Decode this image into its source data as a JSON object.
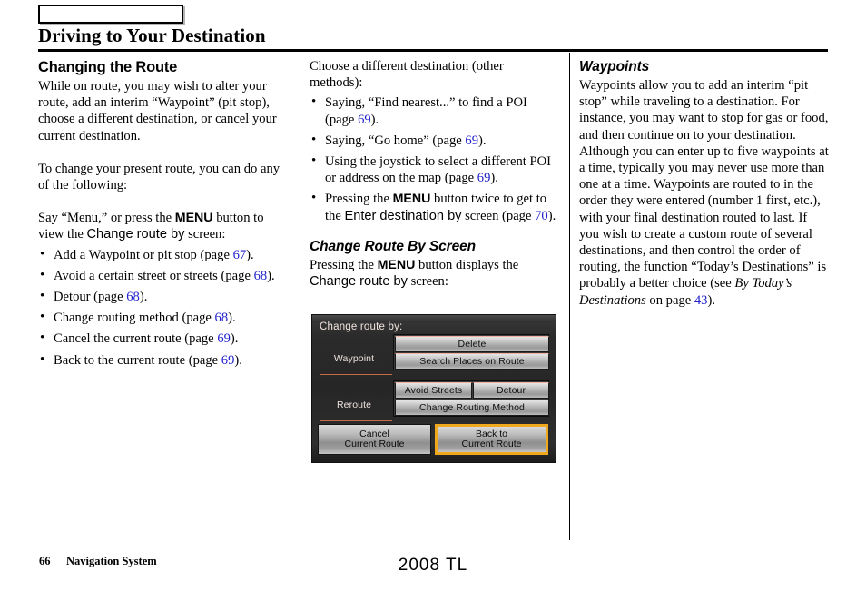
{
  "header": {
    "box_label": "",
    "title": "Driving to Your Destination"
  },
  "left_column": {
    "heading": "Changing the Route",
    "para1": "While on route, you may wish to alter your route, add an interim “Waypoint” (pit stop), choose a different destination, or cancel your current destination.",
    "para2": "To change your present route, you can do any of the following:",
    "para3_a": "Say “Menu,” or press the ",
    "para3_menu": "MENU",
    "para3_b": " button to view the ",
    "para3_screen": "Change route by",
    "para3_c": " screen:",
    "bullets": [
      {
        "text_a": "Add a Waypoint or pit stop (page ",
        "page": "67",
        "text_b": ")."
      },
      {
        "text_a": "Avoid a certain street or streets (page ",
        "page": "68",
        "text_b": ")."
      },
      {
        "text_a": "Detour (page ",
        "page": "68",
        "text_b": ")."
      },
      {
        "text_a": "Change routing method (page ",
        "page": "68",
        "text_b": ")."
      },
      {
        "text_a": "Cancel the current route (page ",
        "page": "69",
        "text_b": ")."
      },
      {
        "text_a": "Back to the current route (page ",
        "page": "69",
        "text_b": ")."
      }
    ]
  },
  "mid_column": {
    "intro": "Choose a different destination (other methods):",
    "bullets": [
      {
        "text_a": "Saying, “Find nearest...” to find a POI (page ",
        "page": "69",
        "text_b": ")."
      },
      {
        "text_a": "Saying, “Go home” (page ",
        "page": "69",
        "text_b": ")."
      },
      {
        "text_a": "Using the joystick to select a different POI or address on the map (page ",
        "page": "69",
        "text_b": ")."
      },
      {
        "text_a": "Pressing the ",
        "menu": "MENU",
        "text_mid": " button twice to get to the ",
        "screen": "Enter destination by",
        "text_c": " screen (page ",
        "page": "70",
        "text_b": ")."
      }
    ],
    "heading": "Change Route By Screen",
    "para_a": "Pressing the ",
    "para_menu": "MENU",
    "para_b": " button displays the ",
    "para_screen": "Change route by",
    "para_c": " screen:"
  },
  "nav_screen": {
    "title": "Change route by:",
    "section_waypoint": "Waypoint",
    "section_reroute": "Reroute",
    "btn_delete": "Delete",
    "btn_search_places": "Search Places on Route",
    "btn_avoid_streets": "Avoid Streets",
    "btn_detour": "Detour",
    "btn_change_routing": "Change Routing Method",
    "btn_cancel_line1": "Cancel",
    "btn_cancel_line2": "Current Route",
    "btn_back_line1": "Back to",
    "btn_back_line2": "Current Route",
    "highlight_color": "#f0a81e",
    "separator_color": "#e07a52"
  },
  "right_column": {
    "heading": "Waypoints",
    "para_a": "Waypoints allow you to add an interim “pit stop” while traveling to a destination. For instance, you may want to stop for gas or food, and then continue on to your destination. Although you can enter up to five waypoints at a time, typically you may never use more than one at a time. Waypoints are routed to in the order they were entered (number 1 first, etc.), with your final destination routed to last. If you wish to create a custom route of several destinations, and then control the order of routing, the function “Today’s Destinations” is probably a better choice (see ",
    "para_italic": "By Today’s Destinations",
    "para_b": " on page ",
    "para_page": "43",
    "para_c": ")."
  },
  "footer": {
    "page_number": "66",
    "section": "Navigation System",
    "model": "2008  TL"
  },
  "colors": {
    "page_ref_blue": "#2222cc",
    "rule_black": "#000000"
  }
}
